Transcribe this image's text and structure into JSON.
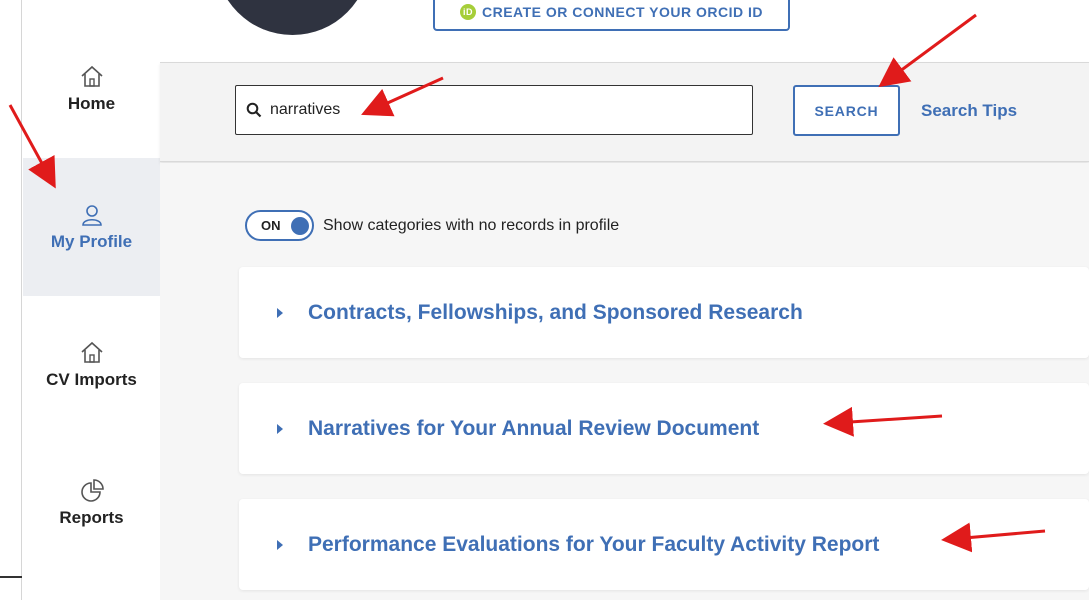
{
  "sidebar": {
    "items": [
      {
        "label": "Home",
        "icon": "home-icon"
      },
      {
        "label": "My Profile",
        "icon": "user-icon",
        "active": true
      },
      {
        "label": "CV Imports",
        "icon": "home-icon"
      },
      {
        "label": "Reports",
        "icon": "pie-chart-icon"
      }
    ]
  },
  "header": {
    "orcid_label": "CREATE OR CONNECT YOUR ORCID ID",
    "orcid_badge": "iD"
  },
  "search": {
    "value": "narratives",
    "button_label": "SEARCH",
    "tips_label": "Search Tips"
  },
  "toggle": {
    "state_label": "ON",
    "text": "Show categories with no records in profile"
  },
  "categories": [
    {
      "title": "Contracts, Fellowships, and Sponsored Research"
    },
    {
      "title": "Narratives for Your Annual Review Document"
    },
    {
      "title": "Performance Evaluations for Your Faculty Activity Report"
    }
  ],
  "colors": {
    "accent": "#3f6fb5",
    "annotation": "#e01b1b",
    "active_bg": "#eceef2"
  }
}
